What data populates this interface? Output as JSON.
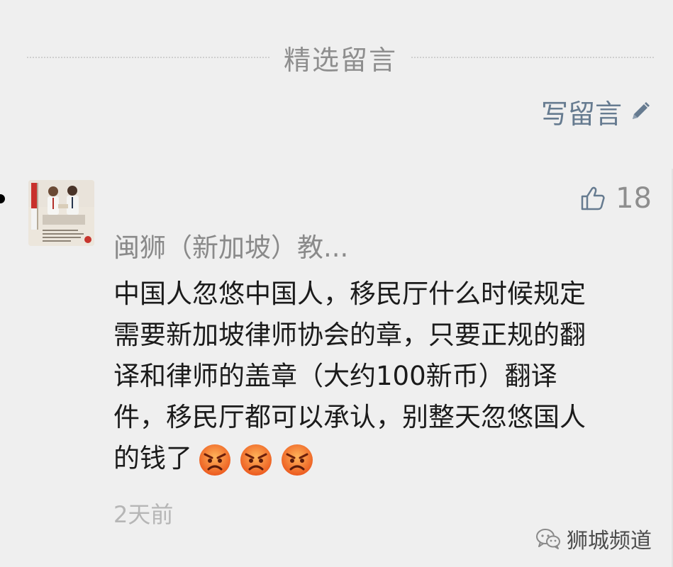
{
  "section": {
    "title": "精选留言"
  },
  "write_comment": {
    "label": "写留言",
    "icon": "pencil-icon"
  },
  "comment": {
    "author": "闽狮（新加坡）教...",
    "likes": "18",
    "lines": [
      "中国人忽悠中国人，移民厅什么时候规定",
      "需要新加坡律师协会的章，只要正规的翻",
      "译和律师的盖章（大约100新币）翻译",
      "件，移民厅都可以承认，别整天忽悠国人",
      "的钱了"
    ],
    "emojis": [
      "angry-face-icon",
      "angry-face-icon",
      "angry-face-icon"
    ],
    "time": "2天前"
  },
  "watermark": {
    "label": "狮城频道"
  },
  "colors": {
    "background": "#efefef",
    "link": "#667b90",
    "text": "#1b1b1b",
    "muted": "#8e8e8e",
    "emoji_orange": "#f07a2a"
  }
}
